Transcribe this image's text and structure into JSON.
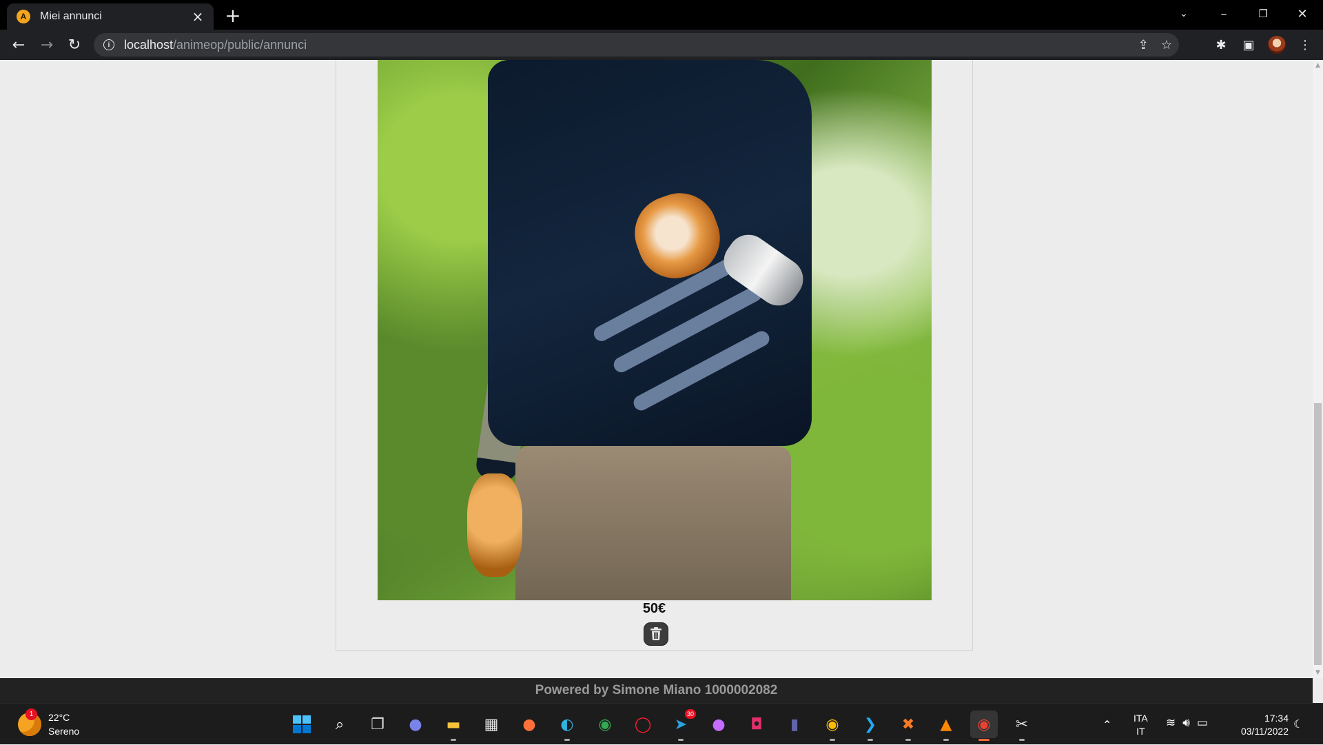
{
  "browser": {
    "tab_title": "Miei annunci",
    "tab_favicon_letter": "A",
    "url_host": "localhost",
    "url_path": "/animeop/public/annunci"
  },
  "listing": {
    "price": "50€"
  },
  "footer": {
    "text": "Powered by Simone Miano 1000002082"
  },
  "taskbar": {
    "weather_temp": "22°C",
    "weather_desc": "Sereno",
    "weather_badge": "1",
    "telegram_badge": "30",
    "lang_top": "ITA",
    "lang_bottom": "IT",
    "time": "17:34",
    "date": "03/11/2022"
  },
  "colors": {
    "page_bg": "#ececec",
    "footer_bg": "#222222",
    "chrome_bg": "#202124",
    "accent_active_app": "#ff6b3d"
  }
}
